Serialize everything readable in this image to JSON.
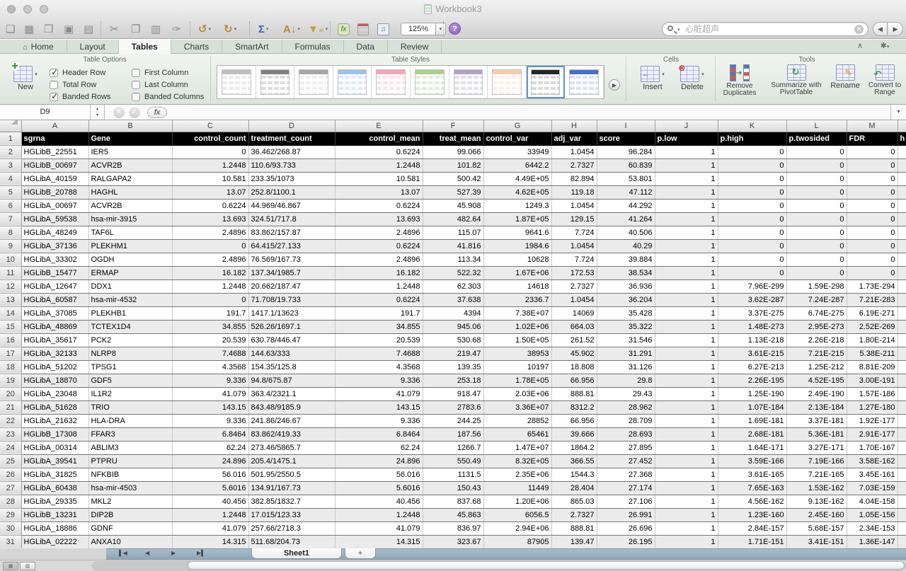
{
  "window": {
    "title": "Workbook3"
  },
  "toolbar": {
    "zoom_level": "125%",
    "icons": [
      {
        "name": "new-workbook-icon",
        "glyph": "❏",
        "dropdown": false
      },
      {
        "name": "template-gallery-icon",
        "glyph": "▦",
        "dropdown": false
      },
      {
        "name": "open-icon",
        "glyph": "❒",
        "dropdown": false
      },
      {
        "name": "save-icon",
        "glyph": "▣",
        "dropdown": false
      },
      {
        "name": "print-icon",
        "glyph": "▤",
        "dropdown": false,
        "divider_after": true
      },
      {
        "name": "cut-icon",
        "glyph": "✂",
        "dropdown": false
      },
      {
        "name": "copy-icon",
        "glyph": "❐",
        "dropdown": false
      },
      {
        "name": "paste-icon",
        "glyph": "▥",
        "dropdown": false
      },
      {
        "name": "format-painter-icon",
        "glyph": "✑",
        "dropdown": false,
        "divider_after": true
      },
      {
        "name": "undo-icon",
        "glyph": "↺",
        "dropdown": true,
        "color": "#b9892f"
      },
      {
        "name": "redo-icon",
        "glyph": "↻",
        "dropdown": true,
        "color": "#b9892f",
        "divider_after": true
      },
      {
        "name": "autosum-icon",
        "glyph": "Σ",
        "dropdown": true,
        "color": "#3b5fc0"
      },
      {
        "name": "sort-icon",
        "glyph": "A↓",
        "dropdown": true,
        "color": "#b9892f"
      },
      {
        "name": "filter-icon",
        "glyph": "▼₌",
        "dropdown": true,
        "color": "#c2a23c",
        "divider_after": true
      }
    ],
    "formula_builder_label": "fx",
    "search": {
      "placeholder": "心脏超声"
    },
    "help_label": "?"
  },
  "ribbon": {
    "tabs": [
      {
        "label": "Home",
        "icon": "home-icon"
      },
      {
        "label": "Layout"
      },
      {
        "label": "Tables"
      },
      {
        "label": "Charts"
      },
      {
        "label": "SmartArt"
      },
      {
        "label": "Formulas"
      },
      {
        "label": "Data"
      },
      {
        "label": "Review"
      }
    ],
    "active_tab": "Tables",
    "table_options": {
      "group_label": "Table Options",
      "new_label": "New",
      "checkboxes": [
        {
          "label": "Header Row",
          "checked": true
        },
        {
          "label": "Total Row",
          "checked": false
        },
        {
          "label": "Banded Rows",
          "checked": true
        },
        {
          "label": "First Column",
          "checked": false
        },
        {
          "label": "Last Column",
          "checked": false
        },
        {
          "label": "Banded Columns",
          "checked": false
        }
      ]
    },
    "table_styles": {
      "group_label": "Table Styles",
      "styles": [
        {
          "name": "light-gray",
          "header": "#bfbfbf",
          "rows": "#ececec"
        },
        {
          "name": "gray-header",
          "header": "#808080",
          "rows": "#dcdcdc"
        },
        {
          "name": "medium-gray",
          "header": "#a6a6a6",
          "rows": "#efefef"
        },
        {
          "name": "blue",
          "header": "#9dc3e6",
          "rows": "#deebf7"
        },
        {
          "name": "pink",
          "header": "#f4a7b9",
          "rows": "#fbe5ea"
        },
        {
          "name": "green",
          "header": "#a9d18e",
          "rows": "#e2efda"
        },
        {
          "name": "purple",
          "header": "#b3a2c7",
          "rows": "#e4dfec"
        },
        {
          "name": "orange",
          "header": "#f8cbad",
          "rows": "#fdf0e6"
        },
        {
          "name": "black",
          "header": "#262626",
          "rows": "#d9d9d9"
        },
        {
          "name": "blue-solid",
          "header": "#4472c4",
          "rows": "#d9e2f3"
        }
      ],
      "selected_index": 8
    },
    "cells": {
      "group_label": "Cells",
      "insert_label": "Insert",
      "delete_label": "Delete"
    },
    "tools": {
      "group_label": "Tools",
      "remove_duplicates_label": "Remove Duplicates",
      "pivottable_label": "Summarize with PivotTable",
      "rename_label": "Rename",
      "convert_label": "Convert to Range"
    }
  },
  "formula_bar": {
    "name_box": "D9",
    "fx_label": "fx",
    "input_value": ""
  },
  "sheet": {
    "column_letters": [
      "A",
      "B",
      "C",
      "D",
      "E",
      "F",
      "G",
      "H",
      "I",
      "J",
      "K",
      "L",
      "M"
    ],
    "header_row": [
      "sgrna",
      "Gene",
      "control_count",
      "treatment_count",
      "control_mean",
      "treat_mean",
      "control_var",
      "adj_var",
      "score",
      "p.low",
      "p.high",
      "p.twosided",
      "FDR",
      "h"
    ],
    "first_row_number": 1,
    "rows": [
      [
        "HGLibB_22551",
        "IER5",
        "0",
        "36.462/268.87",
        "0.6224",
        "99.066",
        "33949",
        "1.0454",
        "96.284",
        "1",
        "0",
        "0",
        "0"
      ],
      [
        "HGLibB_00697",
        "ACVR2B",
        "1.2448",
        "110.6/93.733",
        "1.2448",
        "101.82",
        "6442.2",
        "2.7327",
        "60.839",
        "1",
        "0",
        "0",
        "0"
      ],
      [
        "HGLibA_40159",
        "RALGAPA2",
        "10.581",
        "233.35/1073",
        "10.581",
        "500.42",
        "4.49E+05",
        "82.894",
        "53.801",
        "1",
        "0",
        "0",
        "0"
      ],
      [
        "HGLibB_20788",
        "HAGHL",
        "13.07",
        "252.8/1100.1",
        "13.07",
        "527.39",
        "4.62E+05",
        "119.18",
        "47.112",
        "1",
        "0",
        "0",
        "0"
      ],
      [
        "HGLibA_00697",
        "ACVR2B",
        "0.6224",
        "44.969/46.867",
        "0.6224",
        "45.908",
        "1249.3",
        "1.0454",
        "44.292",
        "1",
        "0",
        "0",
        "0"
      ],
      [
        "HGLibA_59538",
        "hsa-mir-3915",
        "13.693",
        "324.51/717.8",
        "13.693",
        "482.64",
        "1.87E+05",
        "129.15",
        "41.264",
        "1",
        "0",
        "0",
        "0"
      ],
      [
        "HGLibA_48249",
        "TAF6L",
        "2.4896",
        "83.862/157.87",
        "2.4896",
        "115.07",
        "9641.6",
        "7.724",
        "40.506",
        "1",
        "0",
        "0",
        "0"
      ],
      [
        "HGLibA_37136",
        "PLEKHM1",
        "0",
        "64.415/27.133",
        "0.6224",
        "41.816",
        "1984.6",
        "1.0454",
        "40.29",
        "1",
        "0",
        "0",
        "0"
      ],
      [
        "HGLibA_33302",
        "OGDH",
        "2.4896",
        "76.569/167.73",
        "2.4896",
        "113.34",
        "10628",
        "7.724",
        "39.884",
        "1",
        "0",
        "0",
        "0"
      ],
      [
        "HGLibB_15477",
        "ERMAP",
        "16.182",
        "137.34/1985.7",
        "16.182",
        "522.32",
        "1.67E+06",
        "172.53",
        "38.534",
        "1",
        "0",
        "0",
        "0"
      ],
      [
        "HGLibA_12647",
        "DDX1",
        "1.2448",
        "20.662/187.47",
        "1.2448",
        "62.303",
        "14618",
        "2.7327",
        "36.936",
        "1",
        "7.96E-299",
        "1.59E-298",
        "1.73E-294"
      ],
      [
        "HGLibA_60587",
        "hsa-mir-4532",
        "0",
        "71.708/19.733",
        "0.6224",
        "37.638",
        "2336.7",
        "1.0454",
        "36.204",
        "1",
        "3.62E-287",
        "7.24E-287",
        "7.21E-283"
      ],
      [
        "HGLibA_37085",
        "PLEKHB1",
        "191.7",
        "1417.1/13623",
        "191.7",
        "4394",
        "7.38E+07",
        "14069",
        "35.428",
        "1",
        "3.37E-275",
        "6.74E-275",
        "6.19E-271"
      ],
      [
        "HGLibA_48869",
        "TCTEX1D4",
        "34.855",
        "526.26/1697.1",
        "34.855",
        "945.06",
        "1.02E+06",
        "664.03",
        "35.322",
        "1",
        "1.48E-273",
        "2.95E-273",
        "2.52E-269"
      ],
      [
        "HGLibA_35617",
        "PCK2",
        "20.539",
        "630.78/446.47",
        "20.539",
        "530.68",
        "1.50E+05",
        "261.52",
        "31.546",
        "1",
        "1.13E-218",
        "2.26E-218",
        "1.80E-214"
      ],
      [
        "HGLibA_32133",
        "NLRP8",
        "7.4688",
        "144.63/333",
        "7.4688",
        "219.47",
        "38953",
        "45.902",
        "31.291",
        "1",
        "3.61E-215",
        "7.21E-215",
        "5.38E-211"
      ],
      [
        "HGLibA_51202",
        "TPSG1",
        "4.3568",
        "154.35/125.8",
        "4.3568",
        "139.35",
        "10197",
        "18.808",
        "31.126",
        "1",
        "6.27E-213",
        "1.25E-212",
        "8.81E-209"
      ],
      [
        "HGLibA_18870",
        "GDF5",
        "9.336",
        "94.8/675.87",
        "9.336",
        "253.18",
        "1.78E+05",
        "66.956",
        "29.8",
        "1",
        "2.26E-195",
        "4.52E-195",
        "3.00E-191"
      ],
      [
        "HGLibA_23048",
        "IL1R2",
        "41.079",
        "363.4/2321.1",
        "41.079",
        "918.47",
        "2.03E+06",
        "888.81",
        "29.43",
        "1",
        "1.25E-190",
        "2.49E-190",
        "1.57E-186"
      ],
      [
        "HGLibA_51628",
        "TRIO",
        "143.15",
        "843.48/9185.9",
        "143.15",
        "2783.6",
        "3.36E+07",
        "8312.2",
        "28.962",
        "1",
        "1.07E-184",
        "2.13E-184",
        "1.27E-180"
      ],
      [
        "HGLibA_21632",
        "HLA-DRA",
        "9.336",
        "241.86/246.67",
        "9.336",
        "244.25",
        "28852",
        "66.956",
        "28.709",
        "1",
        "1.69E-181",
        "3.37E-181",
        "1.92E-177"
      ],
      [
        "HGLibB_17308",
        "FFAR3",
        "6.8464",
        "83.862/419.33",
        "6.8464",
        "187.56",
        "65461",
        "39.666",
        "28.693",
        "1",
        "2.68E-181",
        "5.36E-181",
        "2.91E-177"
      ],
      [
        "HGLibA_00314",
        "ABLIM3",
        "62.24",
        "273.46/5865.7",
        "62.24",
        "1266.7",
        "1.47E+07",
        "1864.2",
        "27.895",
        "1",
        "1.64E-171",
        "3.27E-171",
        "1.70E-167"
      ],
      [
        "HGLibA_39541",
        "PTPRU",
        "24.896",
        "205.4/1475.1",
        "24.896",
        "550.49",
        "8.32E+05",
        "366.55",
        "27.452",
        "1",
        "3.59E-166",
        "7.19E-166",
        "3.58E-162"
      ],
      [
        "HGLibA_31825",
        "NFKBIB",
        "56.016",
        "501.95/2550.5",
        "56.016",
        "1131.5",
        "2.35E+06",
        "1544.3",
        "27.368",
        "1",
        "3.61E-165",
        "7.21E-165",
        "3.45E-161"
      ],
      [
        "HGLibA_60438",
        "hsa-mir-4503",
        "5.6016",
        "134.91/167.73",
        "5.6016",
        "150.43",
        "11449",
        "28.404",
        "27.174",
        "1",
        "7.65E-163",
        "1.53E-162",
        "7.03E-159"
      ],
      [
        "HGLibA_29335",
        "MKL2",
        "40.456",
        "382.85/1832.7",
        "40.456",
        "837.68",
        "1.20E+06",
        "865.03",
        "27.106",
        "1",
        "4.56E-162",
        "9.13E-162",
        "4.04E-158"
      ],
      [
        "HGLibB_13231",
        "DIP2B",
        "1.2448",
        "17.015/123.33",
        "1.2448",
        "45.863",
        "6056.5",
        "2.7327",
        "26.991",
        "1",
        "1.23E-160",
        "2.45E-160",
        "1.05E-156"
      ],
      [
        "HGLibA_18886",
        "GDNF",
        "41.079",
        "257.66/2718.3",
        "41.079",
        "836.97",
        "2.94E+06",
        "888.81",
        "26.696",
        "1",
        "2.84E-157",
        "5.68E-157",
        "2.34E-153"
      ],
      [
        "HGLibA_02222",
        "ANXA10",
        "14.315",
        "511.68/204.73",
        "14.315",
        "323.67",
        "87905",
        "139.47",
        "26.195",
        "1",
        "1.71E-151",
        "3.41E-151",
        "1.36E-147"
      ]
    ]
  },
  "tabs_bar": {
    "sheet_tab": "Sheet1",
    "add_tab_label": "+"
  },
  "colors": {
    "table_header_bg": "#000000",
    "band_row": "#ebebeb",
    "ribbon_green": "#dce5dc",
    "tab_strip_blue": "#8ba3b5"
  }
}
